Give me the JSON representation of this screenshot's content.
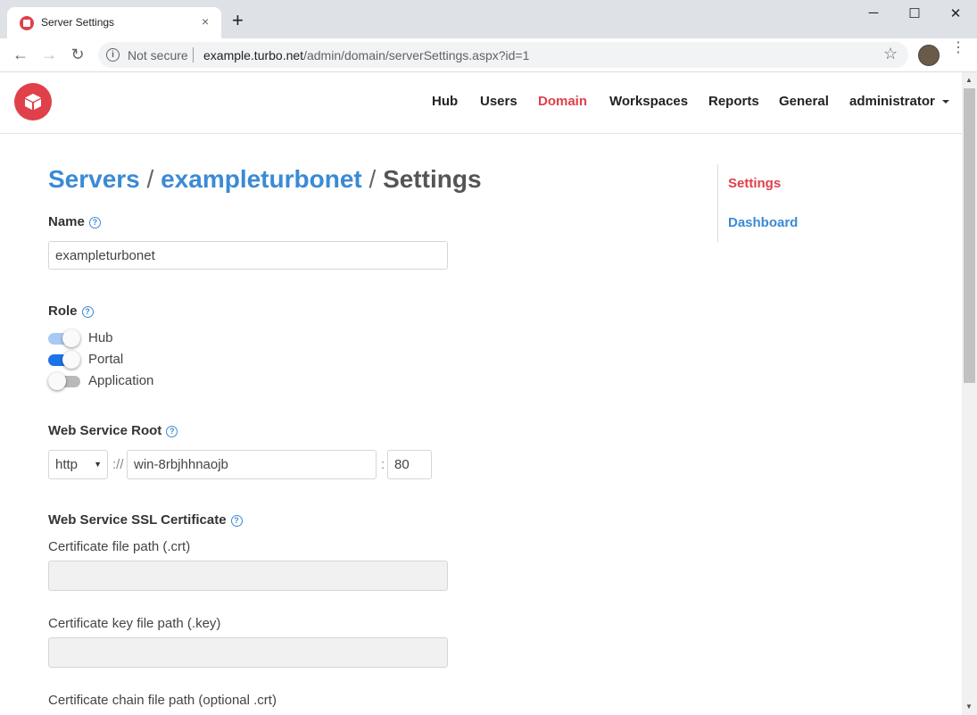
{
  "browser": {
    "tab_title": "Server Settings",
    "tab_close": "×",
    "new_tab": "+",
    "window_controls": {
      "minimize": "─",
      "maximize": "☐",
      "close": "✕"
    },
    "nav": {
      "back": "←",
      "forward": "→",
      "reload": "↻"
    },
    "security_text": "Not secure",
    "url_host": "example.turbo.net",
    "url_path": "/admin/domain/serverSettings.aspx?id=1",
    "bookmark_icon": "☆",
    "menu_icon": "⋮"
  },
  "header": {
    "nav_items": [
      "Hub",
      "Users",
      "Domain",
      "Workspaces",
      "Reports",
      "General",
      "administrator"
    ],
    "active_item": "Domain"
  },
  "breadcrumb": {
    "servers": "Servers",
    "sep1": "/",
    "server": "exampleturbonet",
    "sep2": "/",
    "current": "Settings"
  },
  "sidebar": {
    "items": [
      {
        "label": "Settings",
        "active": true
      },
      {
        "label": "Dashboard",
        "active": false
      }
    ]
  },
  "form": {
    "help_glyph": "?",
    "name": {
      "label": "Name",
      "value": "exampleturbonet"
    },
    "role": {
      "label": "Role",
      "options": [
        {
          "label": "Hub",
          "state": "on-disabled"
        },
        {
          "label": "Portal",
          "state": "on"
        },
        {
          "label": "Application",
          "state": "off"
        }
      ]
    },
    "web_service_root": {
      "label": "Web Service Root",
      "protocol": "http",
      "select_arrow": "▼",
      "scheme_sep": "://",
      "host": "win-8rbjhhnaojb",
      "port_sep": ":",
      "port": "80"
    },
    "ssl": {
      "label": "Web Service SSL Certificate",
      "cert_label": "Certificate file path (.crt)",
      "cert_value": "",
      "key_label": "Certificate key file path (.key)",
      "key_value": "",
      "chain_label": "Certificate chain file path (optional .crt)"
    }
  },
  "colors": {
    "brand_red": "#e0404a",
    "link_blue": "#3b8ad6",
    "toggle_on": "#1a73e8",
    "toggle_on_light": "#a9c9f3",
    "toggle_off": "#b9b9b9"
  }
}
